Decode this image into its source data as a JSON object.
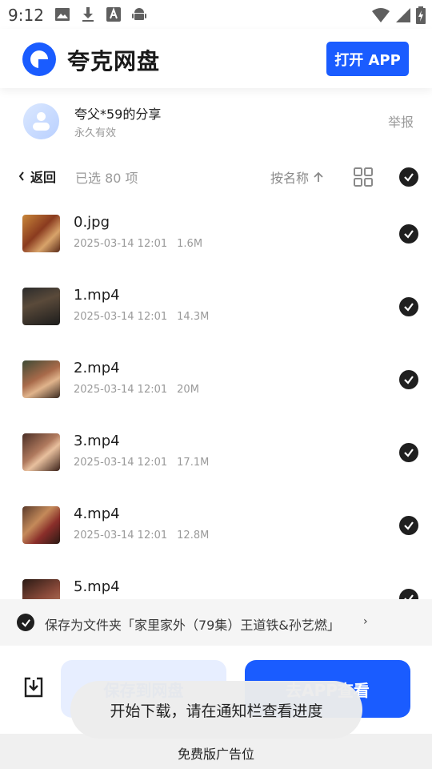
{
  "status_bar": {
    "time": "9:12",
    "left_icons": [
      "image-icon",
      "download-icon",
      "font-icon",
      "android-icon"
    ],
    "right_icons": [
      "wifi-icon",
      "signal-icon",
      "battery-charging-icon"
    ]
  },
  "header": {
    "brand": "夸克网盘",
    "open_app_label": "打开 APP",
    "accent_color": "#1a5cff"
  },
  "share_info": {
    "owner": "夸父*59的分享",
    "validity": "永久有效",
    "report_label": "举报"
  },
  "toolbar": {
    "back_label": "返回",
    "selected_text": "已选 80 项",
    "sort_label": "按名称",
    "sort_icon": "arrow-up-icon",
    "view_icon": "grid-view-icon",
    "select_all_checked": true
  },
  "files": [
    {
      "name": "0.jpg",
      "date": "2025-03-14 12:01",
      "size": "1.6M",
      "checked": true
    },
    {
      "name": "1.mp4",
      "date": "2025-03-14 12:01",
      "size": "14.3M",
      "checked": true
    },
    {
      "name": "2.mp4",
      "date": "2025-03-14 12:01",
      "size": "20M",
      "checked": true
    },
    {
      "name": "3.mp4",
      "date": "2025-03-14 12:01",
      "size": "17.1M",
      "checked": true
    },
    {
      "name": "4.mp4",
      "date": "2025-03-14 12:01",
      "size": "12.8M",
      "checked": true
    },
    {
      "name": "5.mp4",
      "date": "",
      "size": "",
      "checked": true
    }
  ],
  "save_folder": {
    "text": "保存为文件夹「家里家外（79集）王道铁&孙艺燃」",
    "arrow": "›"
  },
  "actions": {
    "download_icon": "download-tray-icon",
    "save_label": "保存到网盘",
    "go_app_label": "去APP查看"
  },
  "toast": {
    "text": "开始下载，请在通知栏查看进度"
  },
  "ad": {
    "text": "免费版广告位"
  }
}
